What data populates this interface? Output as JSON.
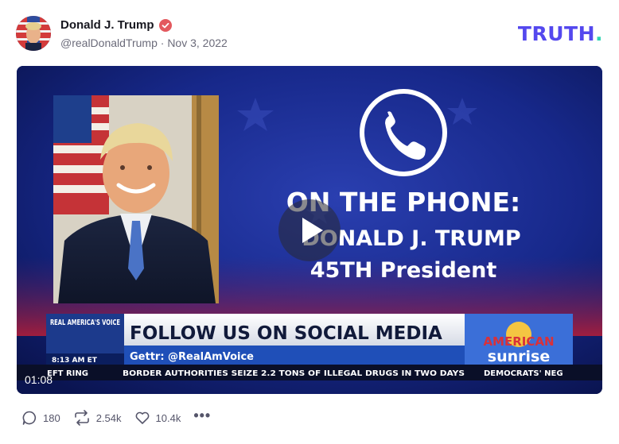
{
  "post": {
    "author_name": "Donald J. Trump",
    "handle": "@realDonaldTrump",
    "separator": "·",
    "date": "Nov 3, 2022"
  },
  "brand": {
    "logo_main": "TRUTH",
    "logo_dot": ".",
    "logo_color": "#5448ee",
    "dot_color": "#2fd4b3"
  },
  "video": {
    "timestamp": "01:08",
    "call_title": "ON THE PHONE:",
    "caller_name": "DONALD J. TRUMP",
    "caller_role": "45TH President",
    "lower_third": {
      "network": "REAL AMERICA'S VOICE",
      "time": "8:13 AM ET",
      "headline": "FOLLOW US ON SOCIAL MEDIA",
      "subline": "Gettr: @RealAmVoice",
      "show_line1": "AMERICAN",
      "show_line2": "sunrise",
      "ticker_left": "EFT RING",
      "ticker_main": "BORDER AUTHORITIES SEIZE 2.2 TONS OF ILLEGAL DRUGS IN TWO DAYS",
      "ticker_right": "DEMOCRATS' NEG"
    }
  },
  "actions": {
    "replies": "180",
    "retruths": "2.54k",
    "likes": "10.4k"
  }
}
